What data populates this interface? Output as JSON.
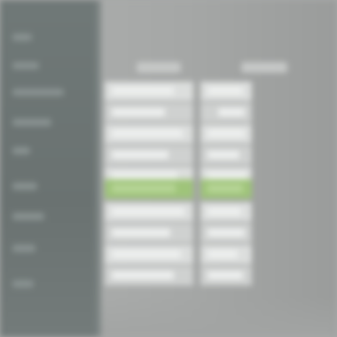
{
  "colors": {
    "sidebar_bg": "#6f7877",
    "content_bg": "#a7a9a8",
    "row_bg": "#dcdedd",
    "row_alt_bg": "#cfd1d0",
    "selected_row_bg": "#9fc47a"
  },
  "sidebar": {
    "items": [
      {
        "label": ""
      },
      {
        "label": ""
      },
      {
        "label": ""
      },
      {
        "label": ""
      },
      {
        "label": ""
      },
      {
        "label": ""
      },
      {
        "label": ""
      },
      {
        "label": ""
      },
      {
        "label": ""
      }
    ]
  },
  "table": {
    "columns": [
      {
        "label": ""
      },
      {
        "label": ""
      }
    ],
    "rows": [
      {
        "c1": "",
        "c2": ""
      },
      {
        "c1": "",
        "c2": ""
      },
      {
        "c1": "",
        "c2": ""
      },
      {
        "c1": "",
        "c2": ""
      },
      {
        "c1": "",
        "c2": ""
      },
      {
        "c1": "",
        "c2": "",
        "selected": true
      },
      {
        "c1": "",
        "c2": ""
      },
      {
        "c1": "",
        "c2": ""
      },
      {
        "c1": "",
        "c2": ""
      },
      {
        "c1": "",
        "c2": ""
      }
    ]
  }
}
